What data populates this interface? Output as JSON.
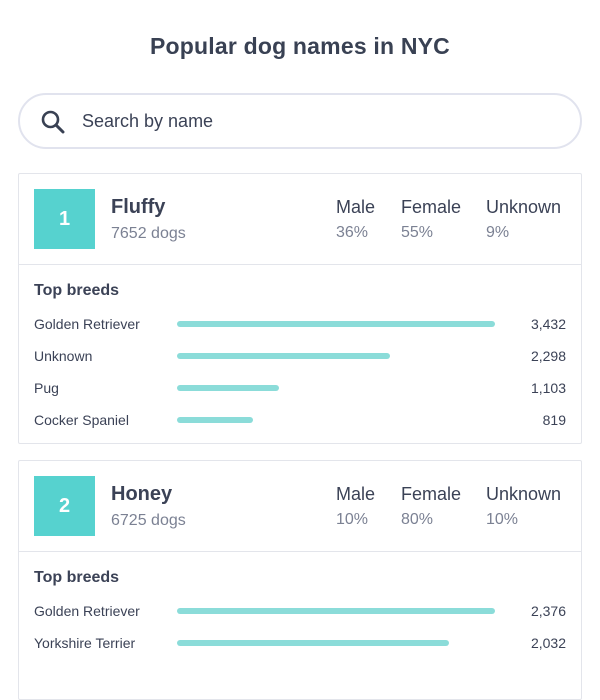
{
  "header": {
    "title": "Popular dog names in NYC"
  },
  "search": {
    "placeholder": "Search by name",
    "value": ""
  },
  "labels": {
    "male": "Male",
    "female": "Female",
    "unknown": "Unknown",
    "top_breeds": "Top breeds"
  },
  "colors": {
    "accent": "#56d2cf",
    "bar": "#8bdcd9",
    "text": "#3b4256",
    "muted": "#7b8193"
  },
  "cards": [
    {
      "rank": "1",
      "name": "Fluffy",
      "count": "7652 dogs",
      "male": "36%",
      "female": "55%",
      "unknown": "9%",
      "breeds": [
        {
          "name": "Golden Retriever",
          "count": "3,432",
          "value": 3432
        },
        {
          "name": "Unknown",
          "count": "2,298",
          "value": 2298
        },
        {
          "name": "Pug",
          "count": "1,103",
          "value": 1103
        },
        {
          "name": "Cocker Spaniel",
          "count": "819",
          "value": 819
        }
      ]
    },
    {
      "rank": "2",
      "name": "Honey",
      "count": "6725 dogs",
      "male": "10%",
      "female": "80%",
      "unknown": "10%",
      "breeds": [
        {
          "name": "Golden Retriever",
          "count": "2,376",
          "value": 2376
        },
        {
          "name": "Yorkshire Terrier",
          "count": "2,032",
          "value": 2032
        }
      ]
    }
  ]
}
